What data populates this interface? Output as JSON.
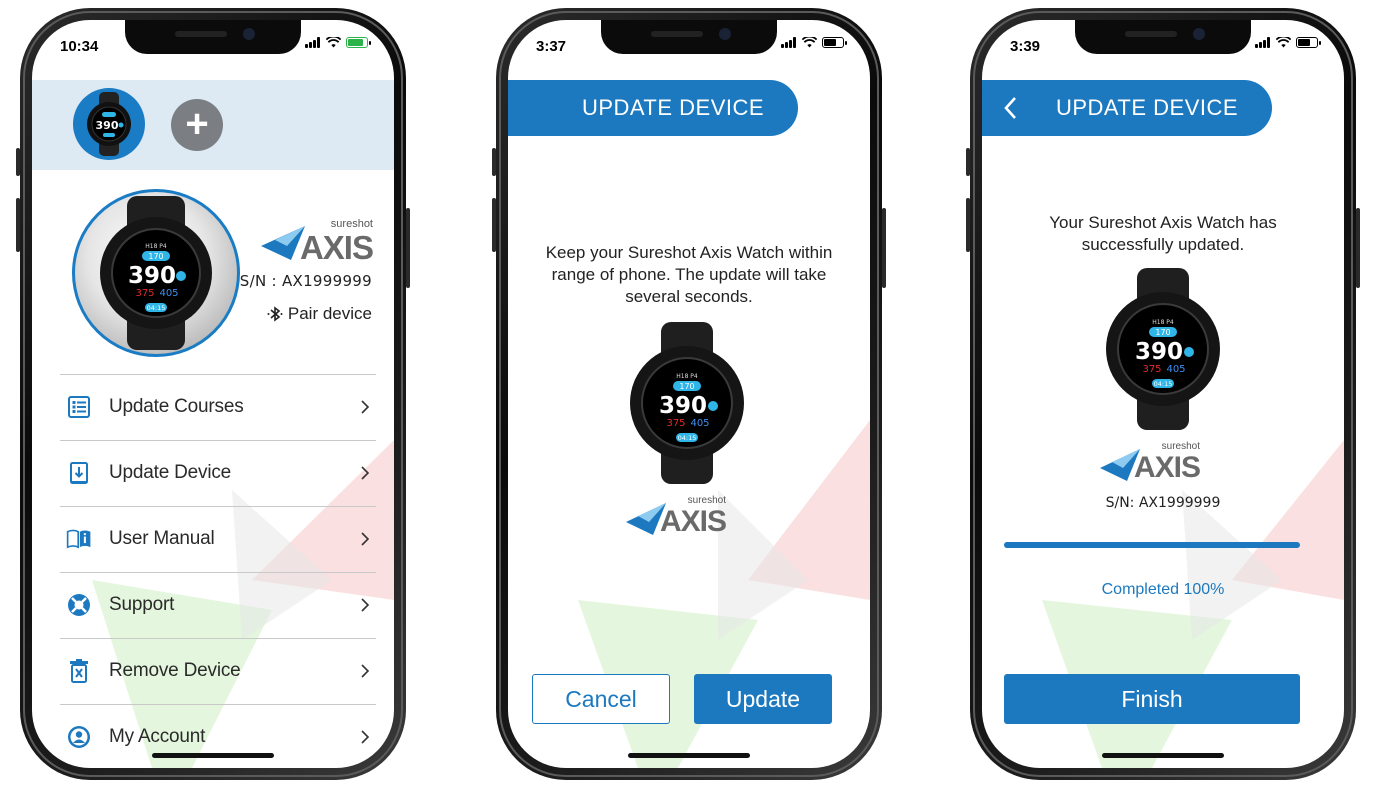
{
  "phones": [
    {
      "status": {
        "time": "10:34"
      },
      "device": {
        "watch": {
          "top_label": "H18 P4",
          "small": "170",
          "main": "390",
          "red": "375",
          "blue": "405",
          "bottom": "04:15"
        },
        "logo_small": "sureshot",
        "logo_big": "AXIS",
        "serial": "S/N : AX1999999",
        "pair_label": "Pair device"
      },
      "add_label": "+",
      "menu": [
        {
          "label": "Update Courses",
          "icon": "list-icon"
        },
        {
          "label": "Update Device",
          "icon": "download-device-icon"
        },
        {
          "label": "User Manual",
          "icon": "book-icon"
        },
        {
          "label": "Support",
          "icon": "lifebuoy-icon"
        },
        {
          "label": "Remove Device",
          "icon": "trash-icon"
        },
        {
          "label": "My Account",
          "icon": "user-circle-icon"
        }
      ]
    },
    {
      "status": {
        "time": "3:37"
      },
      "header": {
        "title": "UPDATE DEVICE"
      },
      "message": "Keep your Sureshot Axis Watch within range of phone. The update will take several seconds.",
      "watch": {
        "top_label": "H18 P4",
        "small": "170",
        "main": "390",
        "red": "375",
        "blue": "405",
        "bottom": "04:15"
      },
      "logo_small": "sureshot",
      "logo_big": "AXIS",
      "cancel_label": "Cancel",
      "update_label": "Update"
    },
    {
      "status": {
        "time": "3:39"
      },
      "header": {
        "title": "UPDATE DEVICE"
      },
      "message": "Your Sureshot Axis Watch has successfully updated.",
      "watch": {
        "top_label": "H18 P4",
        "small": "170",
        "main": "390",
        "red": "375",
        "blue": "405",
        "bottom": "04:15"
      },
      "logo_small": "sureshot",
      "logo_big": "AXIS",
      "serial": "S/N: AX1999999",
      "progress": {
        "value": 1.0,
        "label": "Completed 100%"
      },
      "finish_label": "Finish"
    }
  ],
  "colors": {
    "accent": "#1c79c0",
    "header_band": "#dde9f3",
    "text": "#222222"
  }
}
